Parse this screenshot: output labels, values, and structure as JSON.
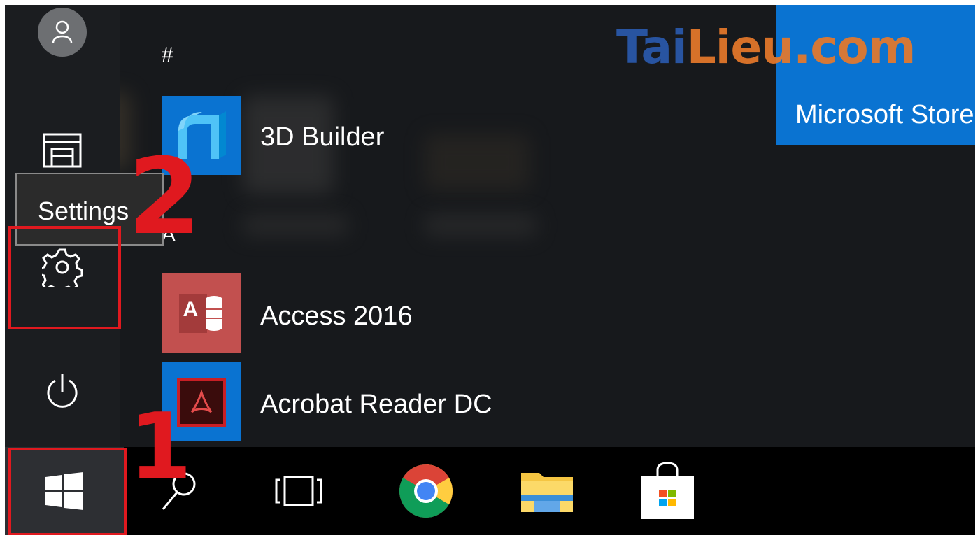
{
  "watermark": {
    "part1": "Tai",
    "part2": "Lieu",
    "part3": ".com"
  },
  "app_list": {
    "section_hash": "#",
    "section_a": "A",
    "apps": [
      {
        "label": "3D Builder",
        "icon": "3d-builder-icon",
        "tile_color": "#0a73d1"
      },
      {
        "label": "Access 2016",
        "icon": "access-icon",
        "tile_color": "#c2504f",
        "icon_text": "A"
      },
      {
        "label": "Acrobat Reader DC",
        "icon": "acrobat-reader-icon",
        "tile_color": "#0a73d1"
      }
    ]
  },
  "store_tile": {
    "label": "Microsoft Store"
  },
  "rail": {
    "user": "user-icon",
    "documents": "file-explorer-icon",
    "settings": "gear-icon",
    "power": "power-icon"
  },
  "tooltip": {
    "text": "Settings"
  },
  "taskbar": {
    "items": [
      "windows-start-icon",
      "search-icon",
      "task-view-icon",
      "chrome-icon",
      "file-explorer-icon",
      "store-icon"
    ]
  },
  "annotations": {
    "step1": "1",
    "step2": "2",
    "color": "#e0191f"
  }
}
